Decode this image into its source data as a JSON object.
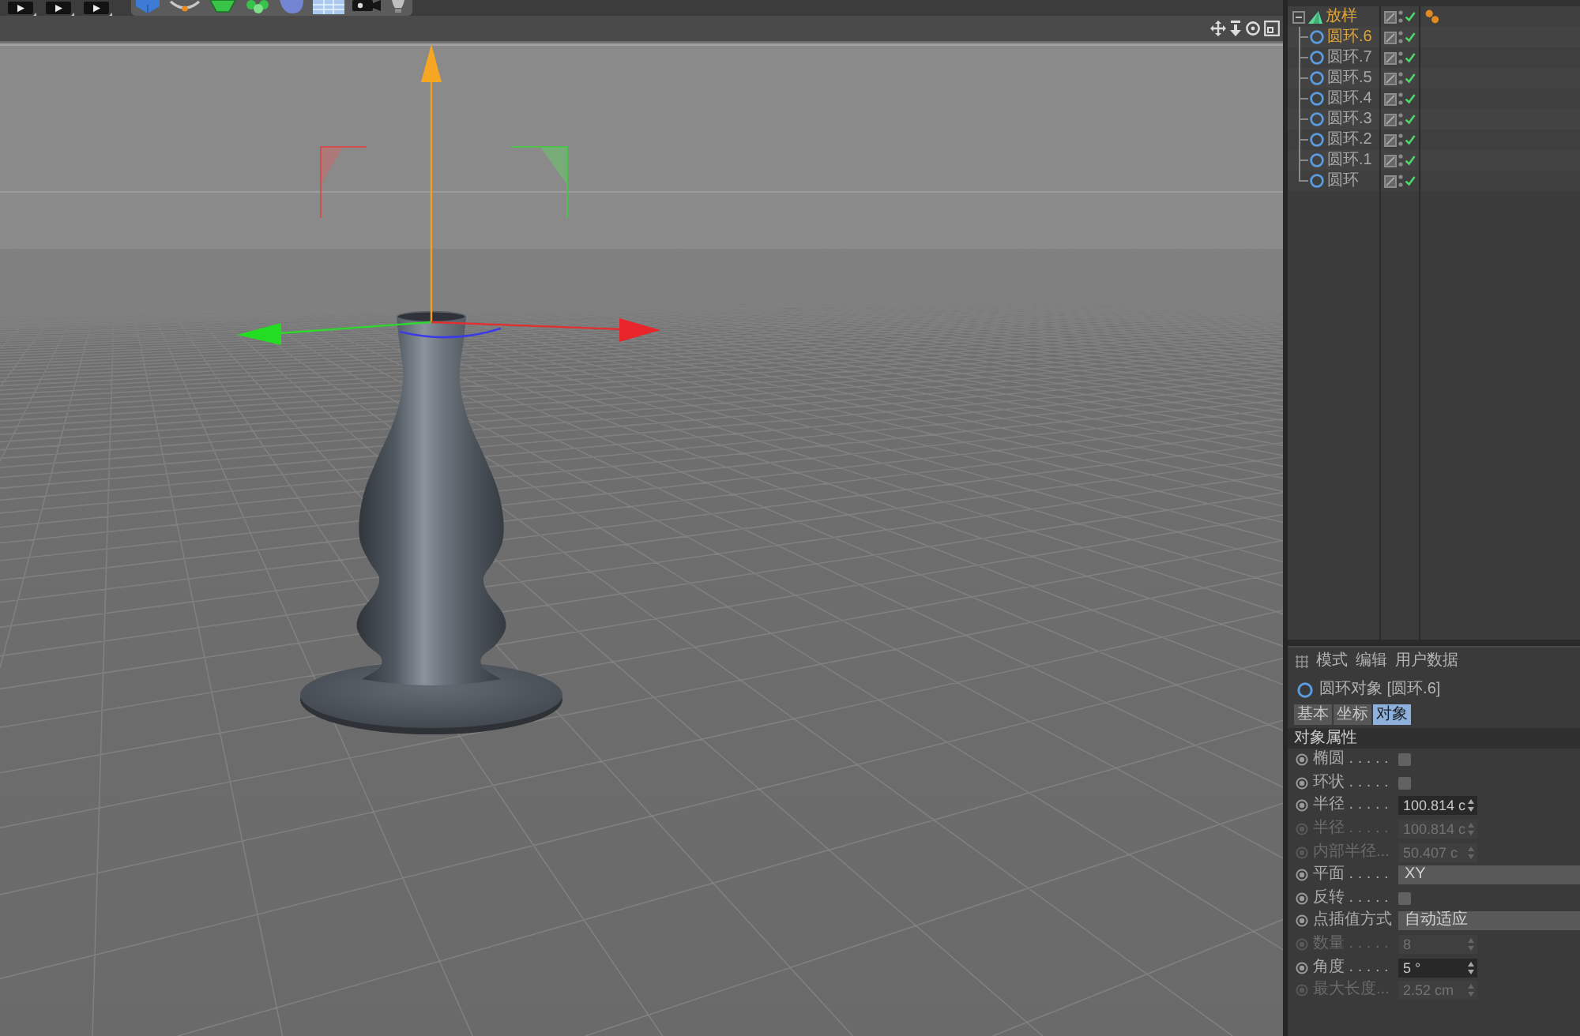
{
  "object_manager": {
    "objects": [
      {
        "name": "放样",
        "kind": "loft",
        "selected": true,
        "expanded": true,
        "enabled": true,
        "has_tag": true,
        "children": [
          {
            "name": "圆环.6",
            "kind": "circle",
            "selected": true,
            "enabled": true,
            "has_tag": false
          },
          {
            "name": "圆环.7",
            "kind": "circle",
            "selected": false,
            "enabled": true,
            "has_tag": false
          },
          {
            "name": "圆环.5",
            "kind": "circle",
            "selected": false,
            "enabled": true,
            "has_tag": false
          },
          {
            "name": "圆环.4",
            "kind": "circle",
            "selected": false,
            "enabled": true,
            "has_tag": false
          },
          {
            "name": "圆环.3",
            "kind": "circle",
            "selected": false,
            "enabled": true,
            "has_tag": false
          },
          {
            "name": "圆环.2",
            "kind": "circle",
            "selected": false,
            "enabled": true,
            "has_tag": false
          },
          {
            "name": "圆环.1",
            "kind": "circle",
            "selected": false,
            "enabled": true,
            "has_tag": false
          },
          {
            "name": "圆环",
            "kind": "circle",
            "selected": false,
            "enabled": true,
            "has_tag": false
          }
        ]
      }
    ]
  },
  "attributes": {
    "menu": [
      "模式",
      "编辑",
      "用户数据"
    ],
    "title": "圆环对象 [圆环.6]",
    "tabs": [
      {
        "label": "基本",
        "selected": false
      },
      {
        "label": "坐标",
        "selected": false
      },
      {
        "label": "对象",
        "selected": true
      }
    ],
    "section": "对象属性",
    "params": [
      {
        "kind": "checkbox",
        "label": "椭圆 . . . . .",
        "checked": false,
        "disabled": false
      },
      {
        "kind": "checkbox",
        "label": "环状 . . . . .",
        "checked": false,
        "disabled": false
      },
      {
        "kind": "number",
        "label": "半径 . . . . .",
        "value": "100.814 c",
        "disabled": false
      },
      {
        "kind": "number",
        "label": "半径 . . . . .",
        "value": "100.814 c",
        "disabled": true
      },
      {
        "kind": "number",
        "label": "内部半径...",
        "value": "50.407 c",
        "disabled": true
      },
      {
        "kind": "dropdown",
        "label": "平面 . . . . .",
        "value": "XY",
        "disabled": false
      },
      {
        "kind": "checkbox",
        "label": "反转 . . . . .",
        "checked": false,
        "disabled": false
      },
      {
        "kind": "dropdown",
        "label": "点插值方式",
        "value": "自动适应",
        "disabled": false
      },
      {
        "kind": "number",
        "label": "数量 . . . . .",
        "value": "8",
        "disabled": true
      },
      {
        "kind": "number",
        "label": "角度 . . . . .",
        "value": "5 °",
        "disabled": false
      },
      {
        "kind": "number",
        "label": "最大长度...",
        "value": "2.52 cm",
        "disabled": true
      }
    ]
  }
}
